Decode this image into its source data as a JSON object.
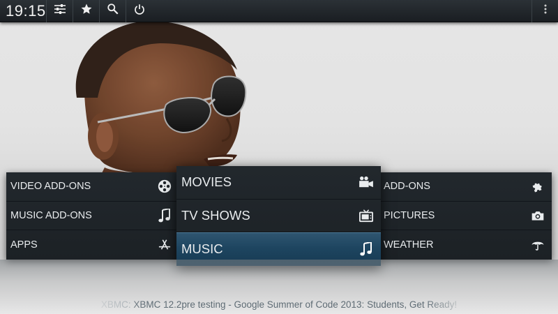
{
  "topbar": {
    "clock": "19:15",
    "buttons": [
      {
        "icon": "sliders-icon"
      },
      {
        "icon": "star-icon"
      },
      {
        "icon": "search-icon"
      },
      {
        "icon": "power-icon"
      }
    ],
    "more_icon": "kebab-menu-icon"
  },
  "menu": {
    "left": [
      {
        "label": "VIDEO ADD-ONS",
        "icon": "film-reel-icon"
      },
      {
        "label": "MUSIC ADD-ONS",
        "icon": "music-note-icon"
      },
      {
        "label": "APPS",
        "icon": "app-store-icon"
      }
    ],
    "center": [
      {
        "label": "MOVIES",
        "icon": "video-camera-icon"
      },
      {
        "label": "TV SHOWS",
        "icon": "tv-icon"
      },
      {
        "label": "MUSIC",
        "icon": "music-note-icon",
        "selected": true
      }
    ],
    "right": [
      {
        "label": "ADD-ONS",
        "icon": "puzzle-icon"
      },
      {
        "label": "PICTURES",
        "icon": "camera-icon"
      },
      {
        "label": "WEATHER",
        "icon": "umbrella-icon"
      }
    ]
  },
  "ticker": {
    "source": "XBMC:",
    "message": "XBMC 12.2pre testing - Google Summer of Code 2013: Students, Get Ready!"
  },
  "colors": {
    "selection": "#1e4560",
    "panel": "#1f2429",
    "text": "#e9ecee"
  }
}
